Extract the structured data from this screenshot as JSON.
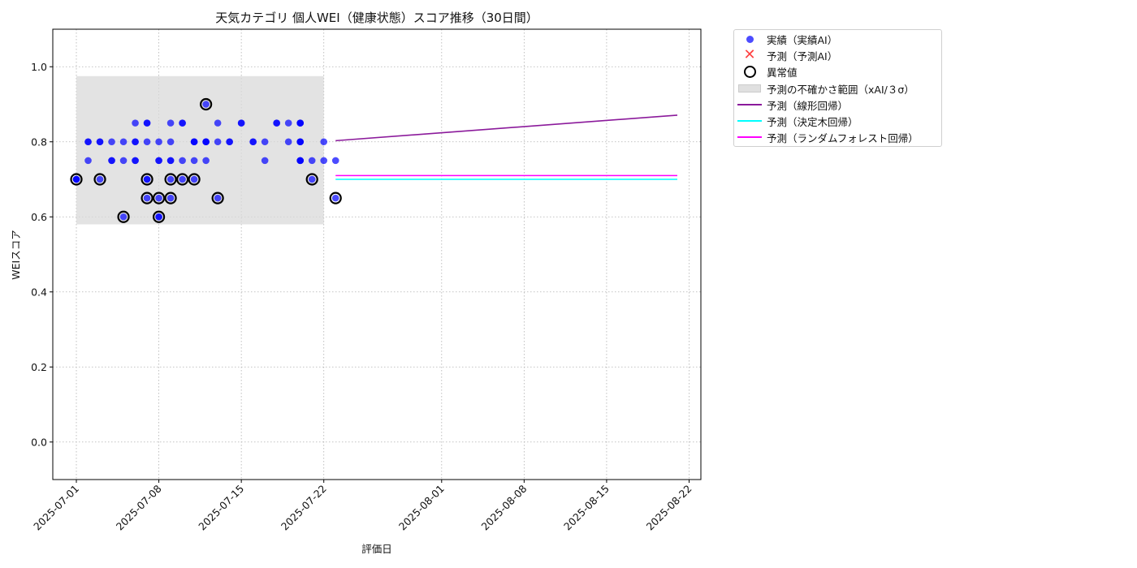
{
  "chart_data": {
    "type": "scatter",
    "title": "天気カテゴリ 個人WEI（健康状態）スコア推移（30日間）",
    "xlabel": "評価日",
    "ylabel": "WEIスコア",
    "xlim": [
      "2025-06-29",
      "2025-08-23"
    ],
    "ylim": [
      -0.1,
      1.1
    ],
    "yticks": [
      0.0,
      0.2,
      0.4,
      0.6,
      0.8,
      1.0
    ],
    "ytick_labels": [
      "0.0",
      "0.2",
      "0.4",
      "0.6",
      "0.8",
      "1.0"
    ],
    "xticks": [
      "2025-07-01",
      "2025-07-08",
      "2025-07-15",
      "2025-07-22",
      "2025-08-01",
      "2025-08-08",
      "2025-08-15",
      "2025-08-22"
    ],
    "grid": true,
    "legend_position": "outside-right-top",
    "legend": [
      {
        "label": "実績（実績AI）",
        "kind": "dot",
        "color": "#0000ff"
      },
      {
        "label": "予測（予測AI）",
        "kind": "x",
        "color": "#ff0000"
      },
      {
        "label": "異常値",
        "kind": "ring",
        "color": "#000000"
      },
      {
        "label": "予測の不確かさ範囲（xAI/３σ）",
        "kind": "patch",
        "color": "#d9d9d9"
      },
      {
        "label": "予測（線形回帰）",
        "kind": "line",
        "color": "#8b1a9b"
      },
      {
        "label": "予測（決定木回帰）",
        "kind": "line",
        "color": "#00ffff"
      },
      {
        "label": "予測（ランダムフォレスト回帰）",
        "kind": "line",
        "color": "#ff00ff"
      }
    ],
    "uncertainty_band": {
      "x": [
        "2025-07-01",
        "2025-07-22"
      ],
      "y": [
        0.58,
        0.975
      ]
    },
    "series": [
      {
        "name": "実績（実績AI）",
        "points": [
          [
            "2025-07-01",
            0.7
          ],
          [
            "2025-07-01",
            0.7
          ],
          [
            "2025-07-01",
            0.7
          ],
          [
            "2025-07-02",
            0.8
          ],
          [
            "2025-07-02",
            0.8
          ],
          [
            "2025-07-02",
            0.75
          ],
          [
            "2025-07-03",
            0.8
          ],
          [
            "2025-07-03",
            0.7
          ],
          [
            "2025-07-03",
            0.8
          ],
          [
            "2025-07-04",
            0.8
          ],
          [
            "2025-07-04",
            0.75
          ],
          [
            "2025-07-04",
            0.75
          ],
          [
            "2025-07-05",
            0.75
          ],
          [
            "2025-07-05",
            0.6
          ],
          [
            "2025-07-05",
            0.8
          ],
          [
            "2025-07-06",
            0.75
          ],
          [
            "2025-07-06",
            0.8
          ],
          [
            "2025-07-06",
            0.75
          ],
          [
            "2025-07-06",
            0.8
          ],
          [
            "2025-07-06",
            0.85
          ],
          [
            "2025-07-07",
            0.85
          ],
          [
            "2025-07-07",
            0.8
          ],
          [
            "2025-07-07",
            0.85
          ],
          [
            "2025-07-07",
            0.7
          ],
          [
            "2025-07-07",
            0.65
          ],
          [
            "2025-07-07",
            0.7
          ],
          [
            "2025-07-08",
            0.6
          ],
          [
            "2025-07-08",
            0.6
          ],
          [
            "2025-07-08",
            0.65
          ],
          [
            "2025-07-08",
            0.75
          ],
          [
            "2025-07-08",
            0.8
          ],
          [
            "2025-07-08",
            0.75
          ],
          [
            "2025-07-09",
            0.7
          ],
          [
            "2025-07-09",
            0.65
          ],
          [
            "2025-07-09",
            0.75
          ],
          [
            "2025-07-09",
            0.75
          ],
          [
            "2025-07-09",
            0.8
          ],
          [
            "2025-07-09",
            0.85
          ],
          [
            "2025-07-10",
            0.7
          ],
          [
            "2025-07-10",
            0.75
          ],
          [
            "2025-07-10",
            0.85
          ],
          [
            "2025-07-10",
            0.85
          ],
          [
            "2025-07-11",
            0.8
          ],
          [
            "2025-07-11",
            0.75
          ],
          [
            "2025-07-11",
            0.7
          ],
          [
            "2025-07-11",
            0.8
          ],
          [
            "2025-07-11",
            0.8
          ],
          [
            "2025-07-12",
            0.8
          ],
          [
            "2025-07-12",
            0.8
          ],
          [
            "2025-07-12",
            0.9
          ],
          [
            "2025-07-12",
            0.8
          ],
          [
            "2025-07-12",
            0.75
          ],
          [
            "2025-07-13",
            0.85
          ],
          [
            "2025-07-13",
            0.8
          ],
          [
            "2025-07-13",
            0.65
          ],
          [
            "2025-07-14",
            0.8
          ],
          [
            "2025-07-14",
            0.8
          ],
          [
            "2025-07-15",
            0.85
          ],
          [
            "2025-07-15",
            0.85
          ],
          [
            "2025-07-16",
            0.8
          ],
          [
            "2025-07-16",
            0.8
          ],
          [
            "2025-07-17",
            0.8
          ],
          [
            "2025-07-17",
            0.75
          ],
          [
            "2025-07-18",
            0.85
          ],
          [
            "2025-07-18",
            0.85
          ],
          [
            "2025-07-19",
            0.8
          ],
          [
            "2025-07-19",
            0.85
          ],
          [
            "2025-07-20",
            0.85
          ],
          [
            "2025-07-20",
            0.75
          ],
          [
            "2025-07-20",
            0.85
          ],
          [
            "2025-07-20",
            0.8
          ],
          [
            "2025-07-20",
            0.8
          ],
          [
            "2025-07-20",
            0.75
          ],
          [
            "2025-07-20",
            0.85
          ],
          [
            "2025-07-20",
            0.75
          ],
          [
            "2025-07-20",
            0.8
          ],
          [
            "2025-07-21",
            0.7
          ],
          [
            "2025-07-21",
            0.75
          ],
          [
            "2025-07-22",
            0.8
          ],
          [
            "2025-07-22",
            0.75
          ],
          [
            "2025-07-23",
            0.75
          ],
          [
            "2025-07-23",
            0.65
          ]
        ]
      },
      {
        "name": "異常値",
        "points": [
          [
            "2025-07-01",
            0.7
          ],
          [
            "2025-07-03",
            0.7
          ],
          [
            "2025-07-05",
            0.6
          ],
          [
            "2025-07-07",
            0.7
          ],
          [
            "2025-07-07",
            0.65
          ],
          [
            "2025-07-08",
            0.6
          ],
          [
            "2025-07-08",
            0.65
          ],
          [
            "2025-07-09",
            0.7
          ],
          [
            "2025-07-09",
            0.65
          ],
          [
            "2025-07-10",
            0.7
          ],
          [
            "2025-07-11",
            0.7
          ],
          [
            "2025-07-12",
            0.9
          ],
          [
            "2025-07-13",
            0.65
          ],
          [
            "2025-07-21",
            0.7
          ],
          [
            "2025-07-23",
            0.65
          ]
        ]
      },
      {
        "name": "予測（線形回帰）",
        "x": [
          "2025-07-23",
          "2025-08-21"
        ],
        "y": [
          0.803,
          0.871
        ]
      },
      {
        "name": "予測（決定木回帰）",
        "x": [
          "2025-07-23",
          "2025-08-21"
        ],
        "y": [
          0.7,
          0.7
        ]
      },
      {
        "name": "予測（ランダムフォレスト回帰）",
        "x": [
          "2025-07-23",
          "2025-08-21"
        ],
        "y": [
          0.71,
          0.71
        ]
      }
    ]
  }
}
